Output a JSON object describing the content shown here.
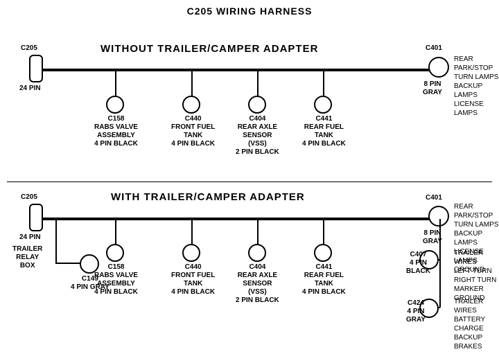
{
  "title": "C205 WIRING HARNESS",
  "section1": {
    "label": "WITHOUT  TRAILER/CAMPER  ADAPTER",
    "connectors": [
      {
        "id": "C205_top",
        "type": "rect",
        "label": "C205",
        "sublabel": "24 PIN"
      },
      {
        "id": "C401_top",
        "type": "circle",
        "label": "C401",
        "sublabel": "8 PIN\nGRAY"
      },
      {
        "id": "C158_top",
        "type": "circle",
        "label": "C158"
      },
      {
        "id": "C440_top",
        "type": "circle",
        "label": "C440"
      },
      {
        "id": "C404_top",
        "type": "circle",
        "label": "C404"
      },
      {
        "id": "C441_top",
        "type": "circle",
        "label": "C441"
      }
    ],
    "c401_desc": "REAR PARK/STOP\nTURN LAMPS\nBACKUP LAMPS\nLICENSE LAMPS",
    "c158_desc": "C158\nRABS VALVE\nASSEMBLY\n4 PIN BLACK",
    "c440_desc": "C440\nFRONT FUEL\nTANK\n4 PIN BLACK",
    "c404_desc": "C404\nREAR AXLE\nSENSOR\n(VSS)\n2 PIN BLACK",
    "c441_desc": "C441\nREAR FUEL\nTANK\n4 PIN BLACK"
  },
  "section2": {
    "label": "WITH  TRAILER/CAMPER  ADAPTER",
    "connectors": [
      {
        "id": "C205_bot",
        "type": "rect",
        "label": "C205",
        "sublabel": "24 PIN"
      },
      {
        "id": "C401_bot",
        "type": "circle",
        "label": "C401",
        "sublabel": "8 PIN\nGRAY"
      },
      {
        "id": "C158_bot",
        "type": "circle",
        "label": "C158"
      },
      {
        "id": "C440_bot",
        "type": "circle",
        "label": "C440"
      },
      {
        "id": "C404_bot",
        "type": "circle",
        "label": "C404"
      },
      {
        "id": "C441_bot",
        "type": "circle",
        "label": "C441"
      },
      {
        "id": "C149",
        "type": "circle",
        "label": "C149",
        "sublabel": "4 PIN GRAY"
      },
      {
        "id": "C407",
        "type": "circle",
        "label": "C407"
      },
      {
        "id": "C424",
        "type": "circle",
        "label": "C424"
      }
    ],
    "c401_desc": "REAR PARK/STOP\nTURN LAMPS\nBACKUP LAMPS\nLICENSE LAMPS\nGROUND",
    "c407_desc": "TRAILER WIRES\nLEFT TURN\nRIGHT TURN\nMARKER\nGROUND",
    "c424_desc": "TRAILER WIRES\nBATTERY CHARGE\nBACKUP\nBRAKES",
    "c149_desc": "TRAILER\nRELAY\nBOX",
    "c407_label": "C407\n4 PIN\nBLACK",
    "c424_label": "C424\n4 PIN\nGRAY"
  }
}
